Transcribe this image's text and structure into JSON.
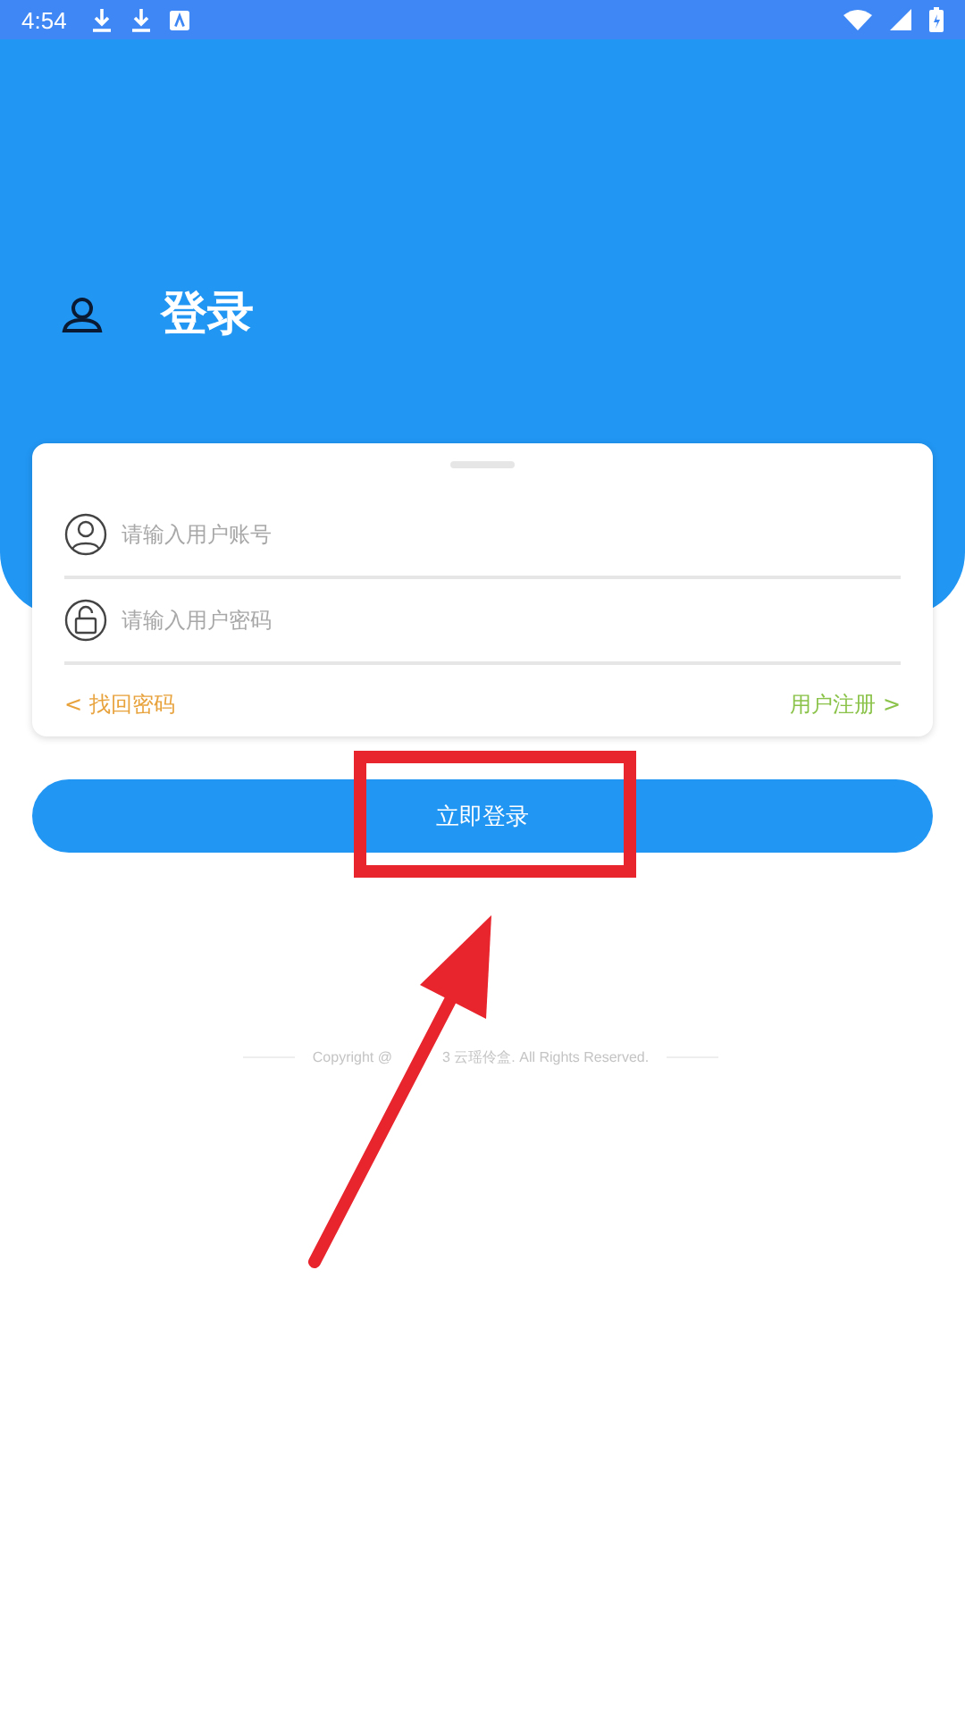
{
  "status_bar": {
    "time": "4:54"
  },
  "header": {
    "title": "登录"
  },
  "login_form": {
    "fields": [
      {
        "kind": "account",
        "placeholder": "请输入用户账号"
      },
      {
        "kind": "password",
        "placeholder": "请输入用户密码"
      }
    ],
    "links": [
      {
        "label": "< 找回密码",
        "color": "#e8a23c"
      },
      {
        "label": "用户注册 >",
        "color": "#8bc34a"
      }
    ]
  },
  "login_button": {
    "label": "立即登录"
  },
  "footer": {
    "copyright_parts": [
      "Copyright @",
      "3 云瑶伶盒. All Rights Reserved."
    ]
  }
}
